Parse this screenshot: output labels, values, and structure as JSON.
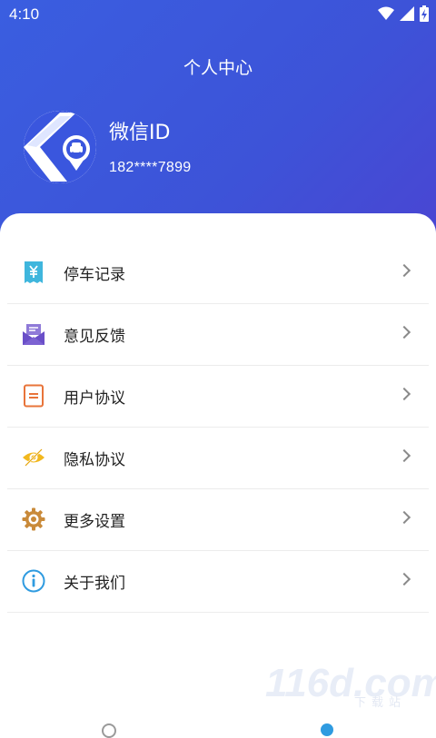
{
  "status_bar": {
    "time": "4:10",
    "icons": [
      "wifi-icon",
      "signal-icon",
      "battery-charging-icon"
    ]
  },
  "header": {
    "title": "个人中心",
    "user_name": "微信ID",
    "phone": "182****7899",
    "avatar_icon": "parking-app-logo-icon"
  },
  "menu": [
    {
      "label": "停车记录",
      "icon": "receipt-yuan-icon"
    },
    {
      "label": "意见反馈",
      "icon": "feedback-envelope-icon"
    },
    {
      "label": "用户协议",
      "icon": "document-icon"
    },
    {
      "label": "隐私协议",
      "icon": "eye-hidden-icon"
    },
    {
      "label": "更多设置",
      "icon": "gear-icon"
    },
    {
      "label": "关于我们",
      "icon": "info-icon"
    }
  ],
  "watermark": {
    "main": "116d.com",
    "sub": "下载站"
  },
  "colors": {
    "header": "#3d53d8",
    "accent": "#2f9be0"
  }
}
